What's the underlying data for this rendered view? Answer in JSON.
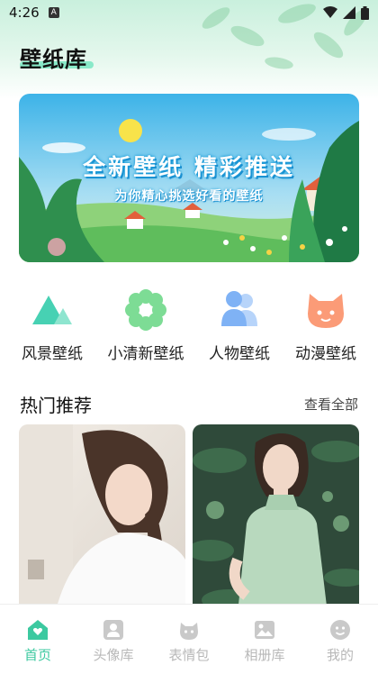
{
  "status_bar": {
    "time": "4:26",
    "notification_glyph": "A"
  },
  "app": {
    "title": "壁纸库"
  },
  "banner": {
    "title": "全新壁纸 精彩推送",
    "subtitle": "为你精心挑选好看的壁纸"
  },
  "categories": [
    {
      "label": "风景壁纸",
      "icon": "mountain-icon",
      "color": "#47d1b3"
    },
    {
      "label": "小清新壁纸",
      "icon": "flower-icon",
      "color": "#7ddc95"
    },
    {
      "label": "人物壁纸",
      "icon": "people-icon",
      "color": "#7fb2f5"
    },
    {
      "label": "动漫壁纸",
      "icon": "cat-icon",
      "color": "#fb9b77"
    }
  ],
  "hot": {
    "title": "热门推荐",
    "see_all": "查看全部"
  },
  "tabs": [
    {
      "label": "首页",
      "icon": "home-icon",
      "active": true
    },
    {
      "label": "头像库",
      "icon": "avatar-icon",
      "active": false
    },
    {
      "label": "表情包",
      "icon": "emoji-pack-icon",
      "active": false
    },
    {
      "label": "相册库",
      "icon": "album-icon",
      "active": false
    },
    {
      "label": "我的",
      "icon": "profile-icon",
      "active": false
    }
  ],
  "colors": {
    "accent": "#3cc9a0",
    "inactive": "#b8b8b8"
  }
}
